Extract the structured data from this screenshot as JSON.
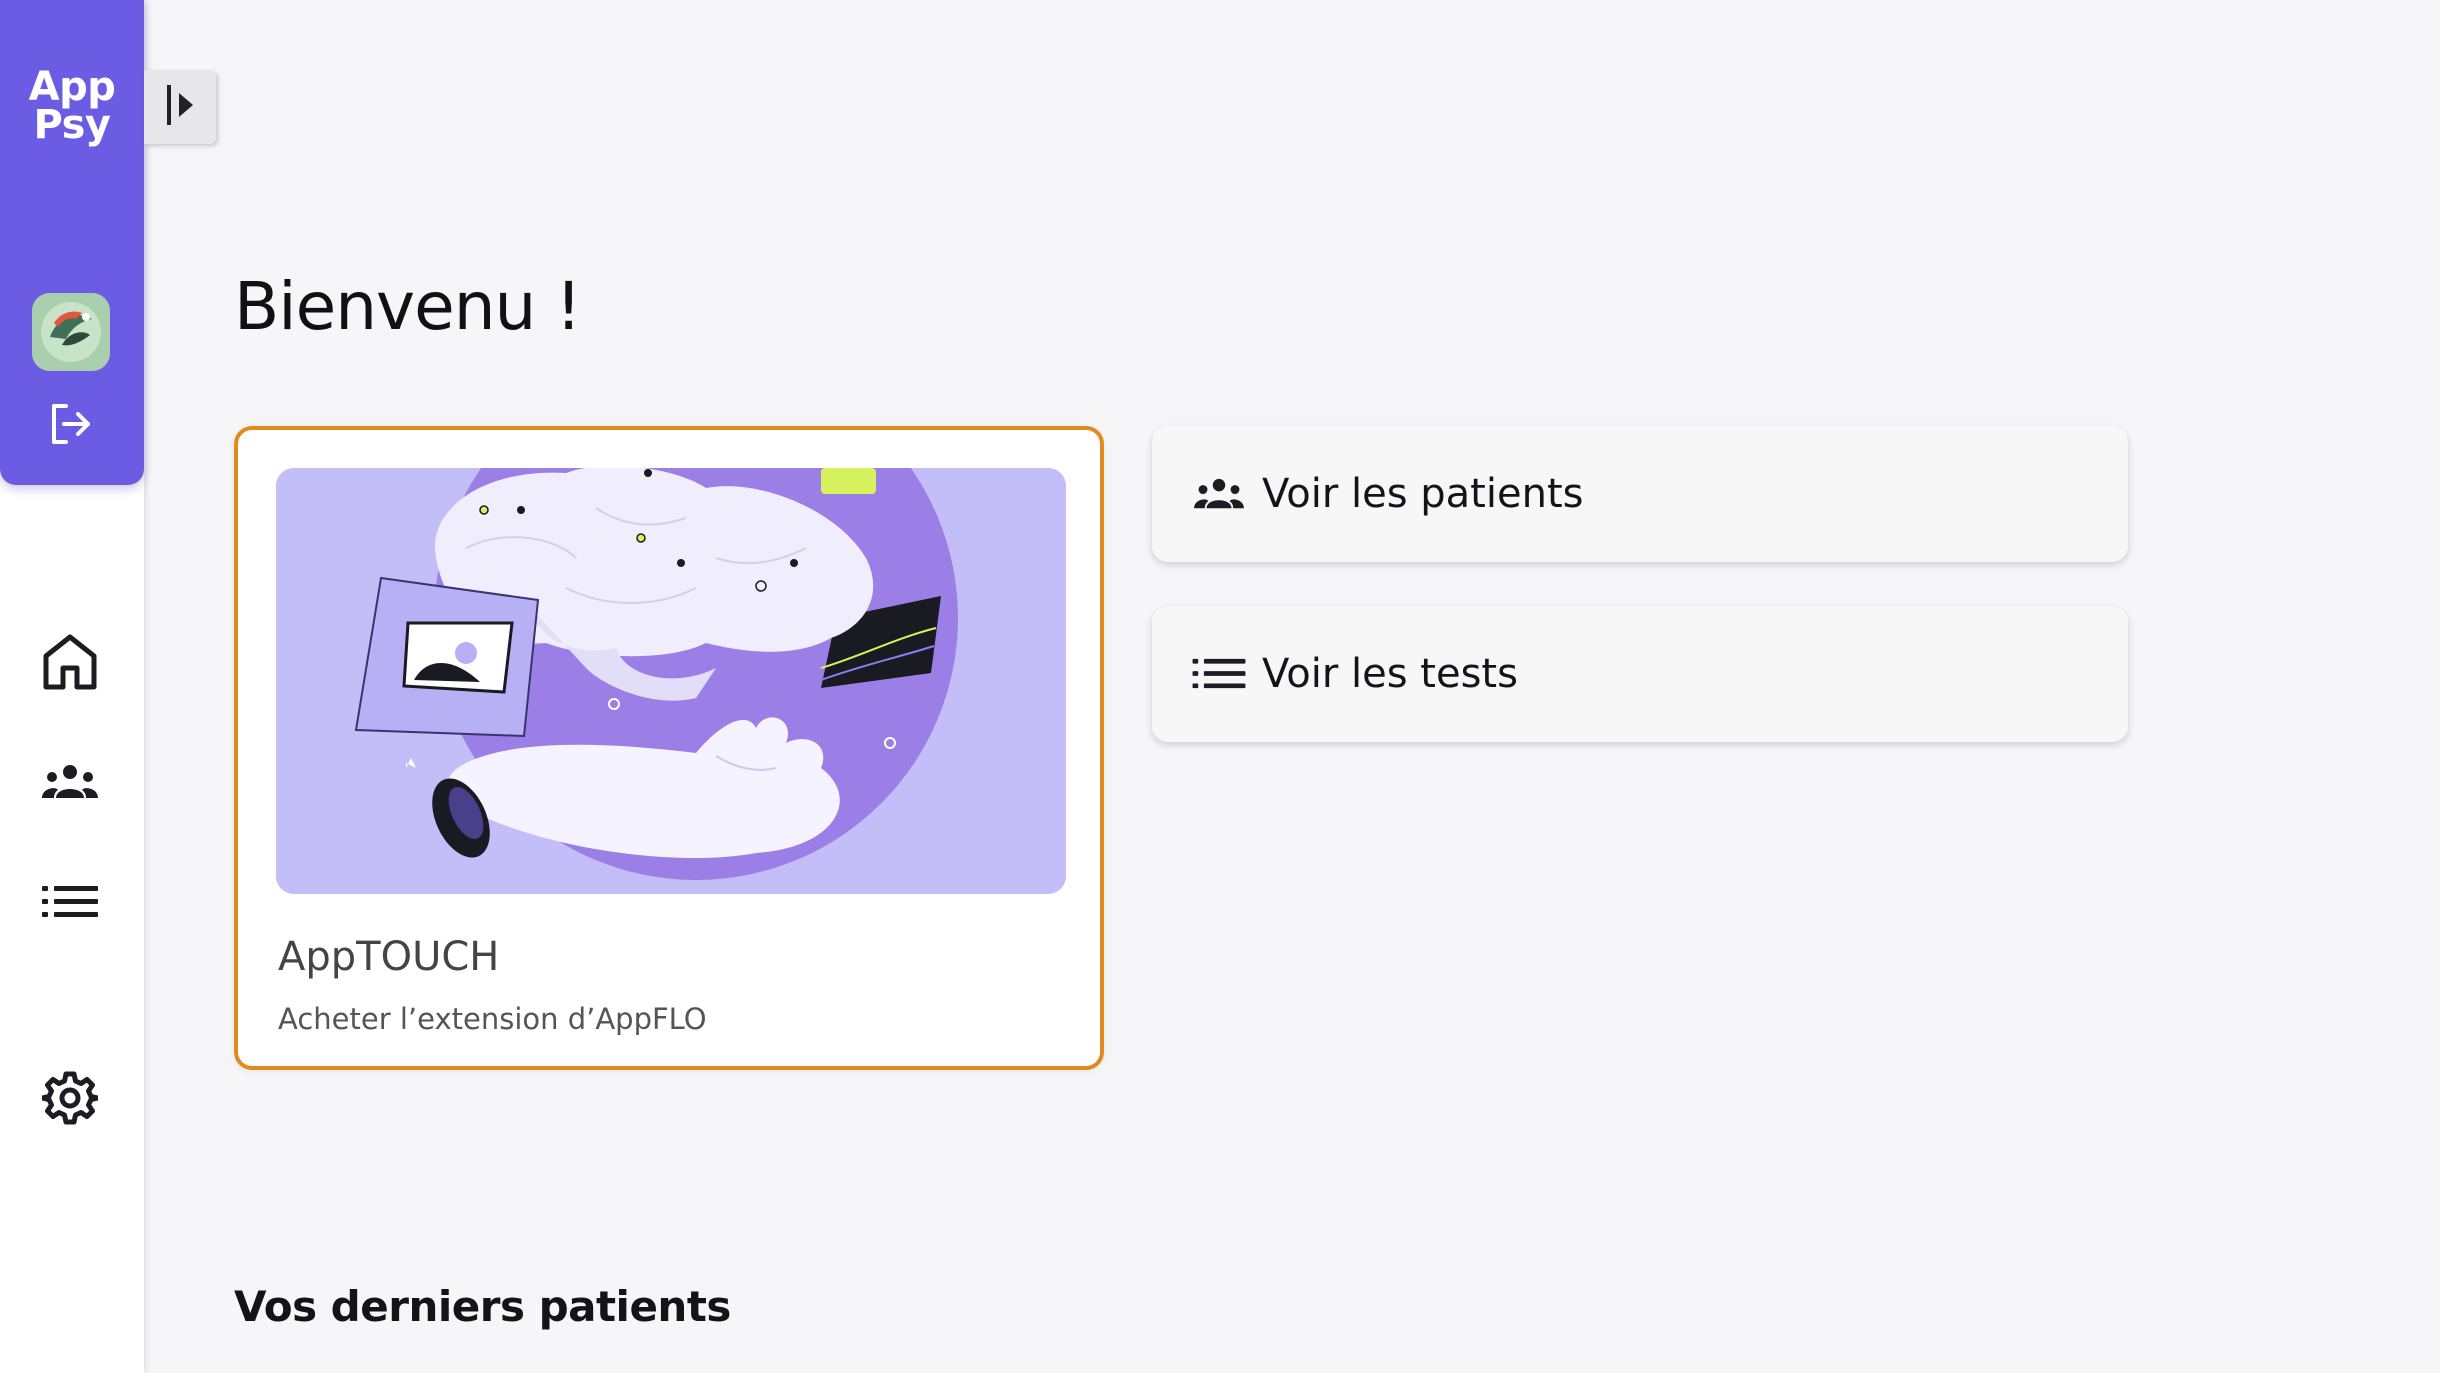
{
  "app": {
    "logo_line1": "App",
    "logo_line2": "Psy",
    "brand_color": "#6c5ce4",
    "accent_color": "#e28a1e"
  },
  "sidebar": {
    "top_icons": [
      "avatar",
      "logout-icon"
    ],
    "nav_items": [
      {
        "icon": "home-icon"
      },
      {
        "icon": "group-icon"
      },
      {
        "icon": "list-icon"
      },
      {
        "icon": "gear-icon"
      }
    ],
    "toggle_icon": "sidebar-expand-icon"
  },
  "main": {
    "title": "Bienvenu !",
    "promo": {
      "name": "AppTOUCH",
      "description": "Acheter l’extension d’AppFLO"
    },
    "actions": [
      {
        "icon": "group-icon",
        "label": "Voir les patients"
      },
      {
        "icon": "list-icon",
        "label": "Voir les tests"
      }
    ],
    "recent_section_title": "Vos derniers patients"
  }
}
